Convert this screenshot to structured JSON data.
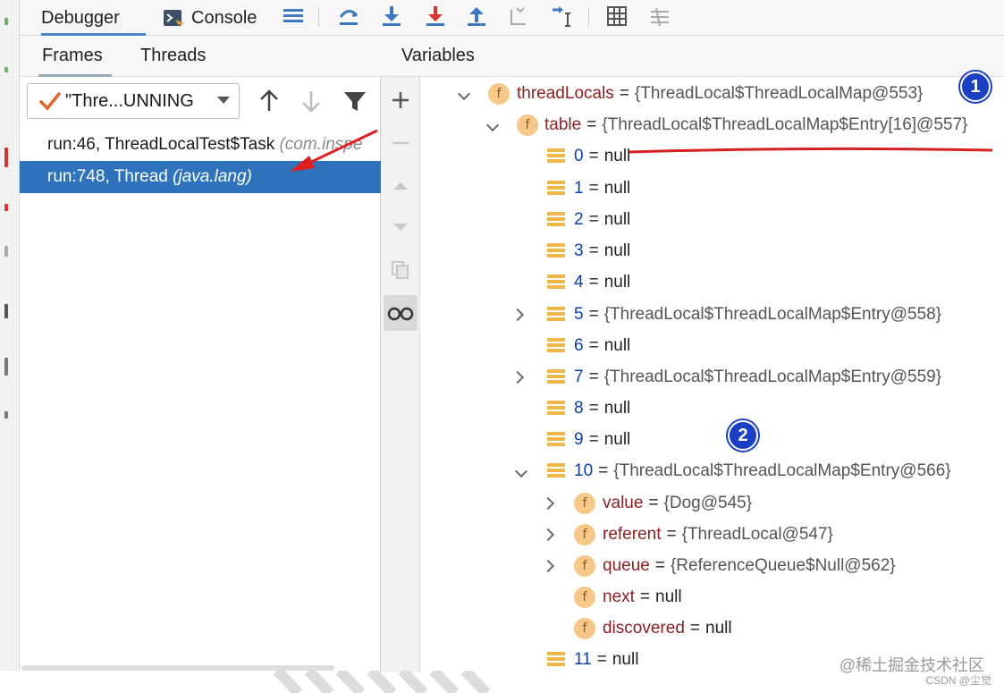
{
  "toolbar": {
    "debugger_tab": "Debugger",
    "console_tab": "Console"
  },
  "frames_panel": {
    "tabs": [
      "Frames",
      "Threads"
    ],
    "thread_selector": "\"Thre...UNNING",
    "frames": [
      {
        "method": "run:46, ThreadLocalTest$Task",
        "package": "(com.inspe"
      },
      {
        "method": "run:748, Thread",
        "package": "(java.lang)"
      }
    ]
  },
  "variables_panel": {
    "title": "Variables",
    "rows": [
      {
        "name": "threadLocals",
        "value": "{ThreadLocal$ThreadLocalMap@553}"
      },
      {
        "name": "table",
        "value": "{ThreadLocal$ThreadLocalMap$Entry[16]@557}"
      },
      {
        "name": "0",
        "value": "null"
      },
      {
        "name": "1",
        "value": "null"
      },
      {
        "name": "2",
        "value": "null"
      },
      {
        "name": "3",
        "value": "null"
      },
      {
        "name": "4",
        "value": "null"
      },
      {
        "name": "5",
        "value": "{ThreadLocal$ThreadLocalMap$Entry@558}"
      },
      {
        "name": "6",
        "value": "null"
      },
      {
        "name": "7",
        "value": "{ThreadLocal$ThreadLocalMap$Entry@559}"
      },
      {
        "name": "8",
        "value": "null"
      },
      {
        "name": "9",
        "value": "null"
      },
      {
        "name": "10",
        "value": "{ThreadLocal$ThreadLocalMap$Entry@566}"
      },
      {
        "name": "value",
        "value": "{Dog@545}"
      },
      {
        "name": "referent",
        "value": "{ThreadLocal@547}"
      },
      {
        "name": "queue",
        "value": "{ReferenceQueue$Null@562}"
      },
      {
        "name": "next",
        "value": "null"
      },
      {
        "name": "discovered",
        "value": "null"
      },
      {
        "name": "11",
        "value": "null"
      }
    ],
    "equals": "=",
    "field_icon": "f"
  },
  "annotations": {
    "badge_1": "1",
    "badge_2": "2",
    "colors": {
      "badge": "#1b3fc2",
      "arrow": "#e02020",
      "underline": "#d42020"
    }
  },
  "watermark": {
    "site": "@稀土掘金技术社区",
    "author": "CSDN @尘觉"
  }
}
